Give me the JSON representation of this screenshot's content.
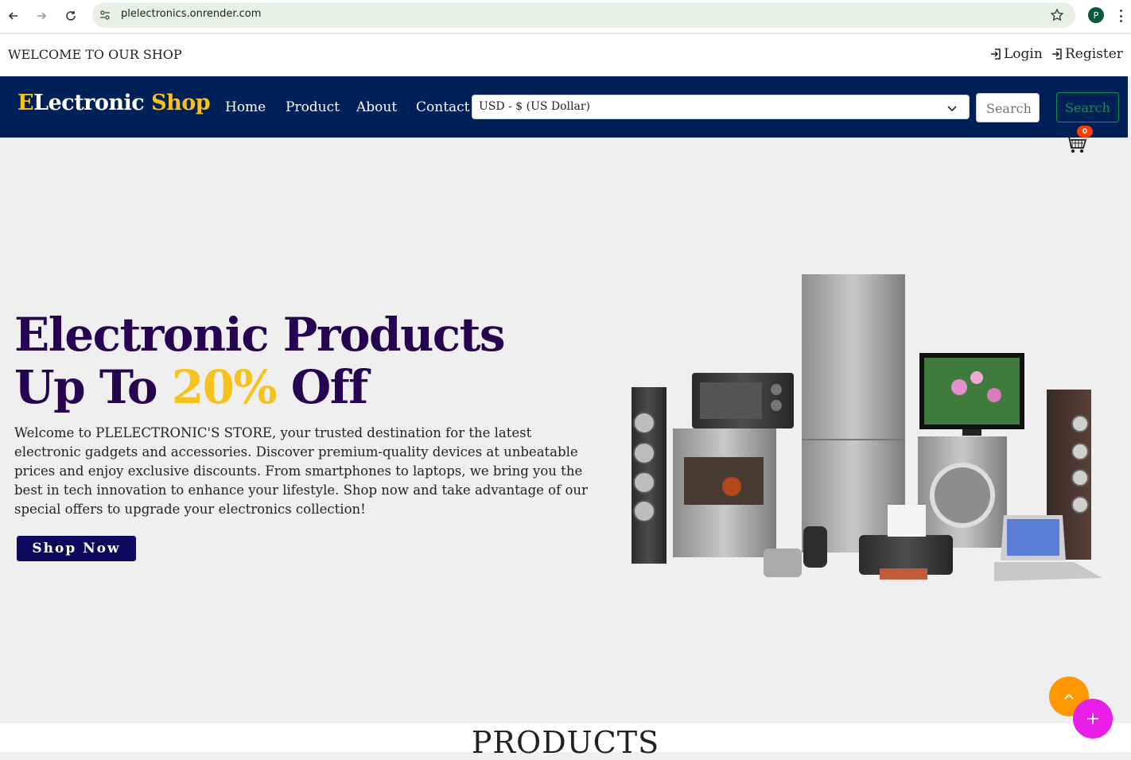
{
  "browser": {
    "url": "plelectronics.onrender.com",
    "profile_initial": "P"
  },
  "topbar": {
    "welcome": "WELCOME TO OUR SHOP",
    "login": "Login",
    "register": "Register"
  },
  "brand": {
    "first_letter": "E",
    "rest": "Lectronic",
    "shop": "Shop"
  },
  "nav": {
    "home": "Home",
    "product": "Product",
    "about": "About",
    "contact": "Contact"
  },
  "currency": {
    "selected": "USD - $ (US Dollar)"
  },
  "search": {
    "placeholder": "Search",
    "button": "Search"
  },
  "cart": {
    "count": "0"
  },
  "hero": {
    "title_line1": "Electronic Products",
    "title_prefix": "Up To ",
    "title_accent": "20%",
    "title_suffix": " Off",
    "description": "Welcome to PLELECTRONIC'S STORE, your trusted destination for the latest electronic gadgets and accessories. Discover premium-quality devices at unbeatable prices and enjoy exclusive discounts. From smartphones to laptops, we bring you the best in tech innovation to enhance your lifestyle. Shop now and take advantage of our special offers to upgrade your electronics collection!",
    "cta": "Shop Now"
  },
  "products": {
    "heading": "PRODUCTS"
  },
  "fab": {
    "plus": "+"
  },
  "colors": {
    "navbar": "#002157",
    "brand_accent": "#f8c21c",
    "hero_title": "#260452",
    "search_green": "#1e8b4e",
    "cta": "#0b0a5e",
    "scroll_top": "#ff9800",
    "fab": "#e91ee9"
  }
}
